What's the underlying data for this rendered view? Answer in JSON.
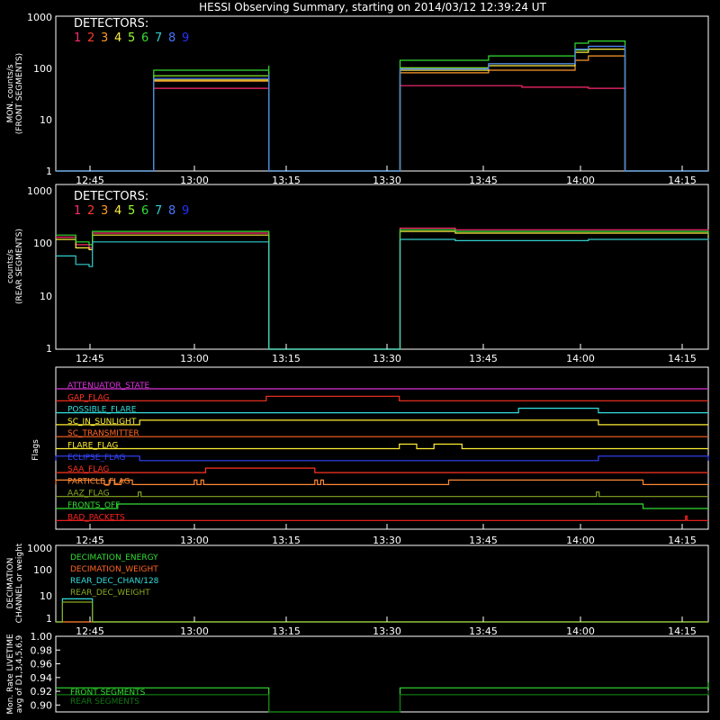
{
  "title": "HESSI Observing Summary, starting on 2014/03/12 12:39:24 UT",
  "x_ticks": [
    "12:45",
    "13:00",
    "13:15",
    "13:30",
    "13:45",
    "14:00",
    "14:15"
  ],
  "detectors": {
    "label": "DETECTORS:",
    "numbers": [
      "1",
      "2",
      "3",
      "4",
      "5",
      "6",
      "7",
      "8",
      "9"
    ],
    "colors": [
      "#ff2a6e",
      "#ff3a2a",
      "#ff9a2a",
      "#ffee44",
      "#99ff33",
      "#33dd33",
      "#33cccc",
      "#4477ff",
      "#2233ff"
    ]
  },
  "panels": {
    "front": {
      "ylabel1": "MON. counts/s",
      "ylabel2": "(FRONT SEGMENTS)",
      "yticks": [
        "1000",
        "100",
        "10",
        "1"
      ]
    },
    "rear": {
      "ylabel1": "counts/s",
      "ylabel2": "(REAR SEGMENTS)",
      "yticks": [
        "1000",
        "100",
        "10",
        "1"
      ]
    },
    "flags": {
      "ylabel": "Flags",
      "rows": [
        {
          "name": "ATTENUATOR_STATE",
          "color": "#dd33dd"
        },
        {
          "name": "GAP_FLAG",
          "color": "#ff3322"
        },
        {
          "name": "POSSIBLE_FLARE",
          "color": "#33dddd"
        },
        {
          "name": "SC_IN_SUNLIGHT",
          "color": "#ffee33"
        },
        {
          "name": "SC_TRANSMITTER",
          "color": "#ff6622"
        },
        {
          "name": "FLARE_FLAG",
          "color": "#ffee33"
        },
        {
          "name": "ECLIPSE_FLAG",
          "color": "#3344ff"
        },
        {
          "name": "SAA_FLAG",
          "color": "#ff3322"
        },
        {
          "name": "PARTICLE_FLAG",
          "color": "#ff8833"
        },
        {
          "name": "AAZ_FLAG",
          "color": "#88aa22"
        },
        {
          "name": "FRONTS_OFF",
          "color": "#33dd33"
        },
        {
          "name": "BAD_PACKETS",
          "color": "#ff2222"
        }
      ]
    },
    "decimation": {
      "ylabel1": "DECIMATION",
      "ylabel2": "CHANNEL or weight",
      "yticks": [
        "1000",
        "100",
        "10",
        "1"
      ],
      "legend": [
        {
          "name": "DECIMATION_ENERGY",
          "color": "#33dd33"
        },
        {
          "name": "DECIMATION_WEIGHT",
          "color": "#ff6622"
        },
        {
          "name": "REAR_DEC_CHAN/128",
          "color": "#33dddd"
        },
        {
          "name": "REAR_DEC_WEIGHT",
          "color": "#88aa22"
        }
      ]
    },
    "livetime": {
      "ylabel1": "Mon. Rate LIVETIME",
      "ylabel2": "avg of D1,3,4,5,6,9",
      "yticks": [
        "1.00",
        "0.98",
        "0.96",
        "0.94",
        "0.92",
        "0.90"
      ],
      "legend": [
        {
          "name": "FRONT SEGMENTS",
          "color": "#33dd33"
        },
        {
          "name": "REAR SEGMENTS",
          "color": "#117711"
        }
      ]
    }
  },
  "chart_data": [
    {
      "type": "line",
      "panel": "front",
      "x_unit": "minutes since 12:39:24 UT",
      "xlim": [
        0,
        98
      ],
      "ylim": [
        1,
        1000
      ],
      "y_scale": "log",
      "series": [
        {
          "name": "1",
          "values": [
            [
              0,
              1
            ],
            [
              14.7,
              1
            ],
            [
              14.7,
              40
            ],
            [
              32,
              42
            ],
            [
              32,
              1
            ],
            [
              51.7,
              1
            ],
            [
              51.7,
              45
            ],
            [
              60,
              45
            ],
            [
              70,
              42
            ],
            [
              80,
              40
            ],
            [
              85.5,
              40
            ],
            [
              85.5,
              1
            ],
            [
              98,
              1
            ]
          ]
        },
        {
          "name": "3",
          "values": [
            [
              0,
              1
            ],
            [
              14.7,
              1
            ],
            [
              14.7,
              55
            ],
            [
              32,
              62
            ],
            [
              32,
              1
            ],
            [
              51.7,
              1
            ],
            [
              51.7,
              80
            ],
            [
              65,
              90
            ],
            [
              78,
              140
            ],
            [
              80,
              170
            ],
            [
              85.5,
              75
            ],
            [
              85.5,
              1
            ],
            [
              98,
              1
            ]
          ]
        },
        {
          "name": "4",
          "values": [
            [
              0,
              1
            ],
            [
              14.7,
              1
            ],
            [
              14.7,
              58
            ],
            [
              32,
              70
            ],
            [
              32,
              1
            ],
            [
              51.7,
              1
            ],
            [
              51.7,
              90
            ],
            [
              65,
              110
            ],
            [
              78,
              200
            ],
            [
              80,
              230
            ],
            [
              85.5,
              80
            ],
            [
              85.5,
              1
            ],
            [
              98,
              1
            ]
          ]
        },
        {
          "name": "5",
          "values": [
            [
              0,
              1
            ],
            [
              14.7,
              1
            ],
            [
              14.7,
              70
            ],
            [
              32,
              85
            ],
            [
              32,
              1
            ],
            [
              51.7,
              1
            ],
            [
              51.7,
              100
            ],
            [
              65,
              120
            ],
            [
              78,
              220
            ],
            [
              80,
              260
            ],
            [
              85.5,
              90
            ],
            [
              85.5,
              1
            ],
            [
              98,
              1
            ]
          ]
        },
        {
          "name": "6",
          "values": [
            [
              0,
              1
            ],
            [
              14.7,
              1
            ],
            [
              14.7,
              90
            ],
            [
              32,
              110
            ],
            [
              32,
              1
            ],
            [
              51.7,
              1
            ],
            [
              51.7,
              140
            ],
            [
              65,
              170
            ],
            [
              78,
              300
            ],
            [
              80,
              330
            ],
            [
              85.5,
              110
            ],
            [
              85.5,
              1
            ],
            [
              98,
              1
            ]
          ]
        },
        {
          "name": "8",
          "values": [
            [
              0,
              1
            ],
            [
              14.7,
              1
            ],
            [
              14.7,
              62
            ],
            [
              32,
              75
            ],
            [
              32,
              1
            ],
            [
              51.7,
              1
            ],
            [
              51.7,
              95
            ],
            [
              65,
              120
            ],
            [
              78,
              230
            ],
            [
              80,
              260
            ],
            [
              85.5,
              85
            ],
            [
              85.5,
              1
            ],
            [
              98,
              1
            ]
          ]
        }
      ]
    },
    {
      "type": "line",
      "panel": "rear",
      "x_unit": "minutes since 12:39:24 UT",
      "xlim": [
        0,
        98
      ],
      "ylim": [
        1,
        1000
      ],
      "y_scale": "log",
      "series": [
        {
          "name": "1",
          "values": [
            [
              0,
              110
            ],
            [
              3,
              80
            ],
            [
              5,
              70
            ],
            [
              5.5,
              130
            ],
            [
              32,
              130
            ],
            [
              32,
              1
            ],
            [
              51.7,
              1
            ],
            [
              51.7,
              160
            ],
            [
              60,
              150
            ],
            [
              80,
              150
            ],
            [
              98,
              120
            ]
          ]
        },
        {
          "name": "4",
          "values": [
            [
              0,
              100
            ],
            [
              3,
              70
            ],
            [
              5,
              65
            ],
            [
              5.5,
              120
            ],
            [
              32,
              120
            ],
            [
              32,
              1
            ],
            [
              51.7,
              1
            ],
            [
              51.7,
              140
            ],
            [
              60,
              130
            ],
            [
              80,
              130
            ],
            [
              98,
              110
            ]
          ]
        },
        {
          "name": "6",
          "values": [
            [
              0,
              120
            ],
            [
              3,
              90
            ],
            [
              5,
              80
            ],
            [
              5.5,
              140
            ],
            [
              32,
              140
            ],
            [
              32,
              1
            ],
            [
              51.7,
              1
            ],
            [
              51.7,
              150
            ],
            [
              60,
              140
            ],
            [
              80,
              140
            ],
            [
              98,
              120
            ]
          ]
        },
        {
          "name": "7",
          "values": [
            [
              0,
              50
            ],
            [
              3,
              35
            ],
            [
              5,
              32
            ],
            [
              5.5,
              90
            ],
            [
              32,
              90
            ],
            [
              32,
              1
            ],
            [
              51.7,
              1
            ],
            [
              51.7,
              100
            ],
            [
              60,
              95
            ],
            [
              80,
              100
            ],
            [
              98,
              95
            ]
          ]
        }
      ]
    },
    {
      "type": "line",
      "panel": "flags",
      "x_unit": "minutes since 12:39:24 UT",
      "xlim": [
        0,
        98
      ],
      "series": [
        {
          "name": "ATTENUATOR_STATE",
          "intervals": []
        },
        {
          "name": "GAP_FLAG",
          "intervals": [
            [
              31.6,
              51.6
            ]
          ]
        },
        {
          "name": "POSSIBLE_FLARE",
          "intervals": [
            [
              69.5,
              81.5
            ]
          ]
        },
        {
          "name": "SC_IN_SUNLIGHT",
          "intervals": [
            [
              12.6,
              81.5
            ]
          ]
        },
        {
          "name": "SC_TRANSMITTER",
          "intervals": []
        },
        {
          "name": "FLARE_FLAG",
          "intervals": [
            [
              51.6,
              54.2
            ],
            [
              56.8,
              61
            ]
          ]
        },
        {
          "name": "ECLIPSE_FLAG",
          "intervals": [
            [
              0,
              12.6
            ],
            [
              81.5,
              98
            ]
          ]
        },
        {
          "name": "SAA_FLAG",
          "intervals": [
            [
              22.5,
              38.9
            ]
          ]
        },
        {
          "name": "PARTICLE_FLAG",
          "intervals": [
            [
              0,
              7.3
            ],
            [
              8,
              8.8
            ],
            [
              9.8,
              11.5
            ],
            [
              20.8,
              21.2
            ],
            [
              21.8,
              22.2
            ],
            [
              38.9,
              39.3
            ],
            [
              39.8,
              40.2
            ],
            [
              59,
              88.2
            ]
          ]
        },
        {
          "name": "AAZ_FLAG",
          "intervals": [
            [
              12.4,
              12.8
            ],
            [
              81.2,
              81.6
            ]
          ]
        },
        {
          "name": "FRONTS_OFF",
          "intervals": [
            [
              9.3,
              88.2
            ]
          ]
        },
        {
          "name": "BAD_PACKETS",
          "intervals": [
            [
              94.6,
              94.8
            ]
          ]
        }
      ]
    },
    {
      "type": "line",
      "panel": "decimation",
      "x_unit": "minutes since 12:39:24 UT",
      "xlim": [
        0,
        98
      ],
      "ylim": [
        1,
        1000
      ],
      "y_scale": "log",
      "series": [
        {
          "name": "DECIMATION_ENERGY",
          "values": [
            [
              0,
              1
            ],
            [
              98,
              1
            ]
          ]
        },
        {
          "name": "DECIMATION_WEIGHT",
          "values": [
            [
              0,
              1
            ],
            [
              98,
              1
            ]
          ]
        },
        {
          "name": "REAR_DEC_CHAN/128",
          "values": [
            [
              0,
              1
            ],
            [
              1,
              1
            ],
            [
              1,
              8
            ],
            [
              5.5,
              8
            ],
            [
              5.5,
              1
            ],
            [
              98,
              1
            ]
          ]
        },
        {
          "name": "REAR_DEC_WEIGHT",
          "values": [
            [
              0,
              1
            ],
            [
              1,
              1
            ],
            [
              1,
              6
            ],
            [
              5.5,
              6
            ],
            [
              5.5,
              1
            ],
            [
              98,
              1
            ]
          ]
        }
      ]
    },
    {
      "type": "line",
      "panel": "livetime",
      "x_unit": "minutes since 12:39:24 UT",
      "xlim": [
        0,
        98
      ],
      "ylim": [
        0.89,
        1.0
      ],
      "series": [
        {
          "name": "FRONT SEGMENTS",
          "values": [
            [
              0,
              0.925
            ],
            [
              32,
              0.922
            ],
            [
              32,
              0.89
            ],
            [
              51.7,
              0.89
            ],
            [
              51.7,
              0.925
            ],
            [
              98,
              0.933
            ]
          ]
        },
        {
          "name": "REAR SEGMENTS",
          "values": [
            [
              0,
              0.915
            ],
            [
              32,
              0.913
            ],
            [
              32,
              0.89
            ],
            [
              51.7,
              0.89
            ],
            [
              51.7,
              0.915
            ],
            [
              98,
              0.921
            ]
          ]
        }
      ]
    }
  ]
}
